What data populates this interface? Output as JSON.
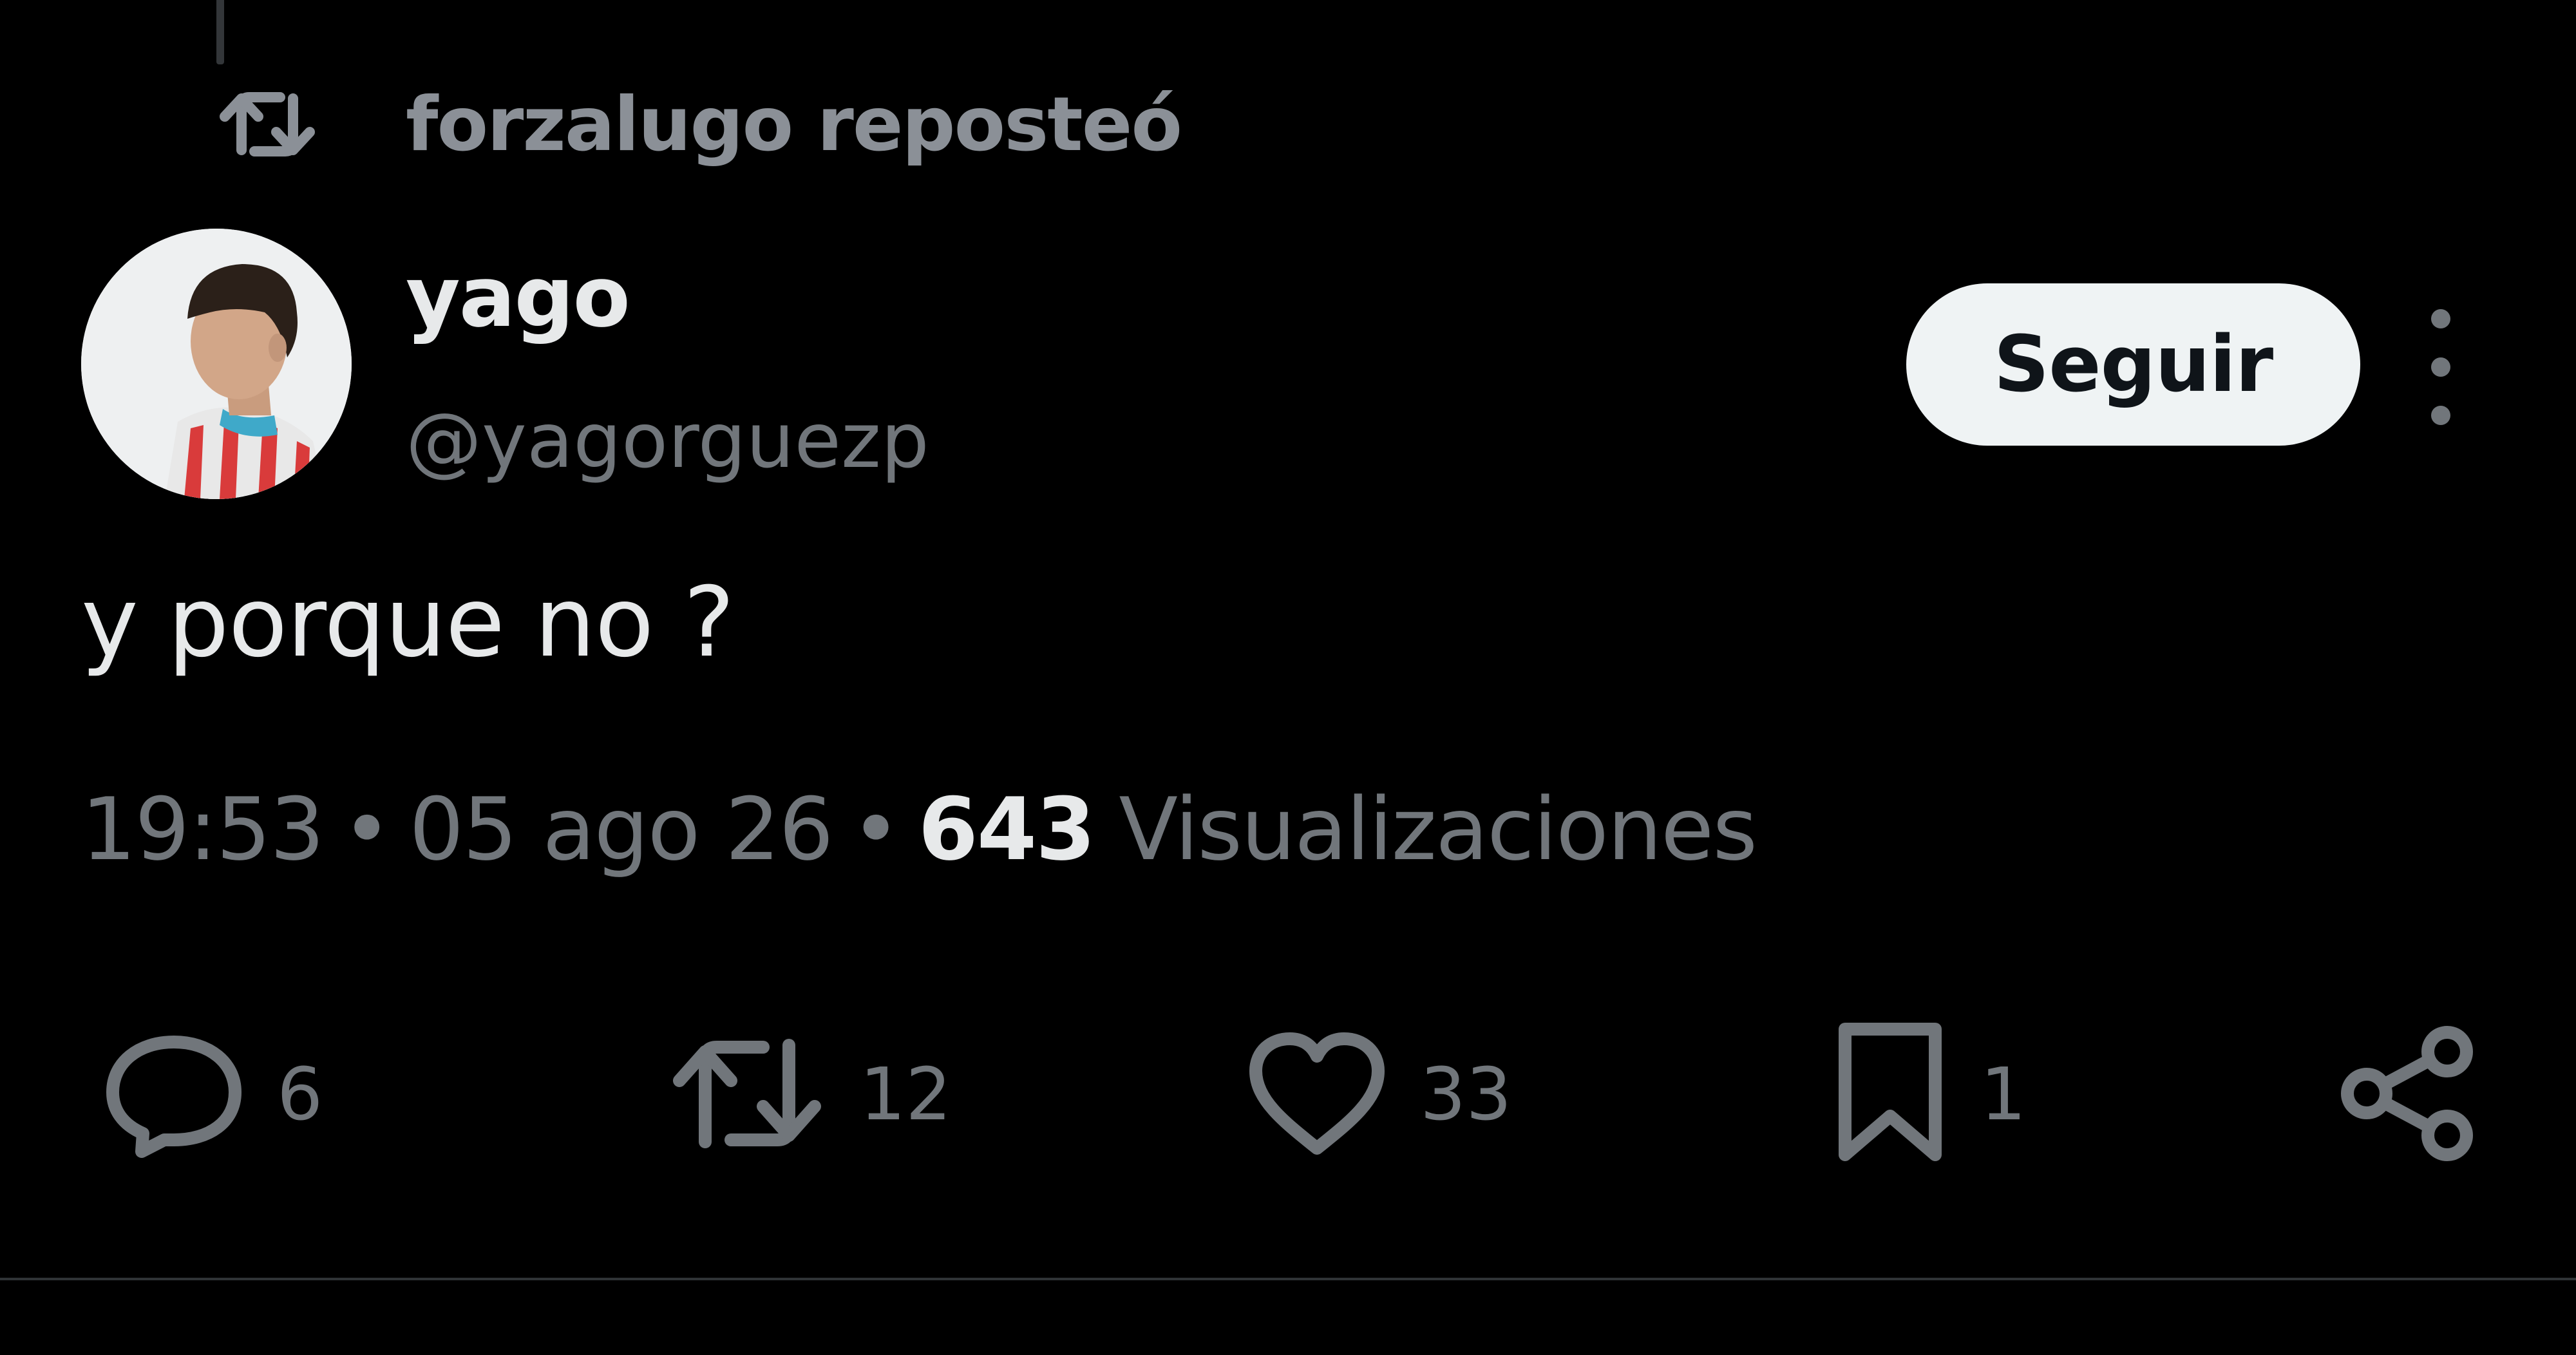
{
  "repost": {
    "label": "forzalugo reposteó",
    "icon": "retweet-icon"
  },
  "author": {
    "name": "yago",
    "handle": "@yagorguezp"
  },
  "follow_label": "Seguir",
  "tweet": {
    "text": "y porque no ?"
  },
  "meta": {
    "time": "19:53",
    "date": "05 ago 26",
    "separator": "•",
    "views_count": "643",
    "views_label": "Visualizaciones"
  },
  "actions": {
    "replies": "6",
    "retweets": "12",
    "likes": "33",
    "bookmarks": "1"
  },
  "colors": {
    "background": "#000000",
    "primary_text": "#e7e9ea",
    "secondary_text": "#71767b",
    "button_bg": "#eff3f4"
  }
}
